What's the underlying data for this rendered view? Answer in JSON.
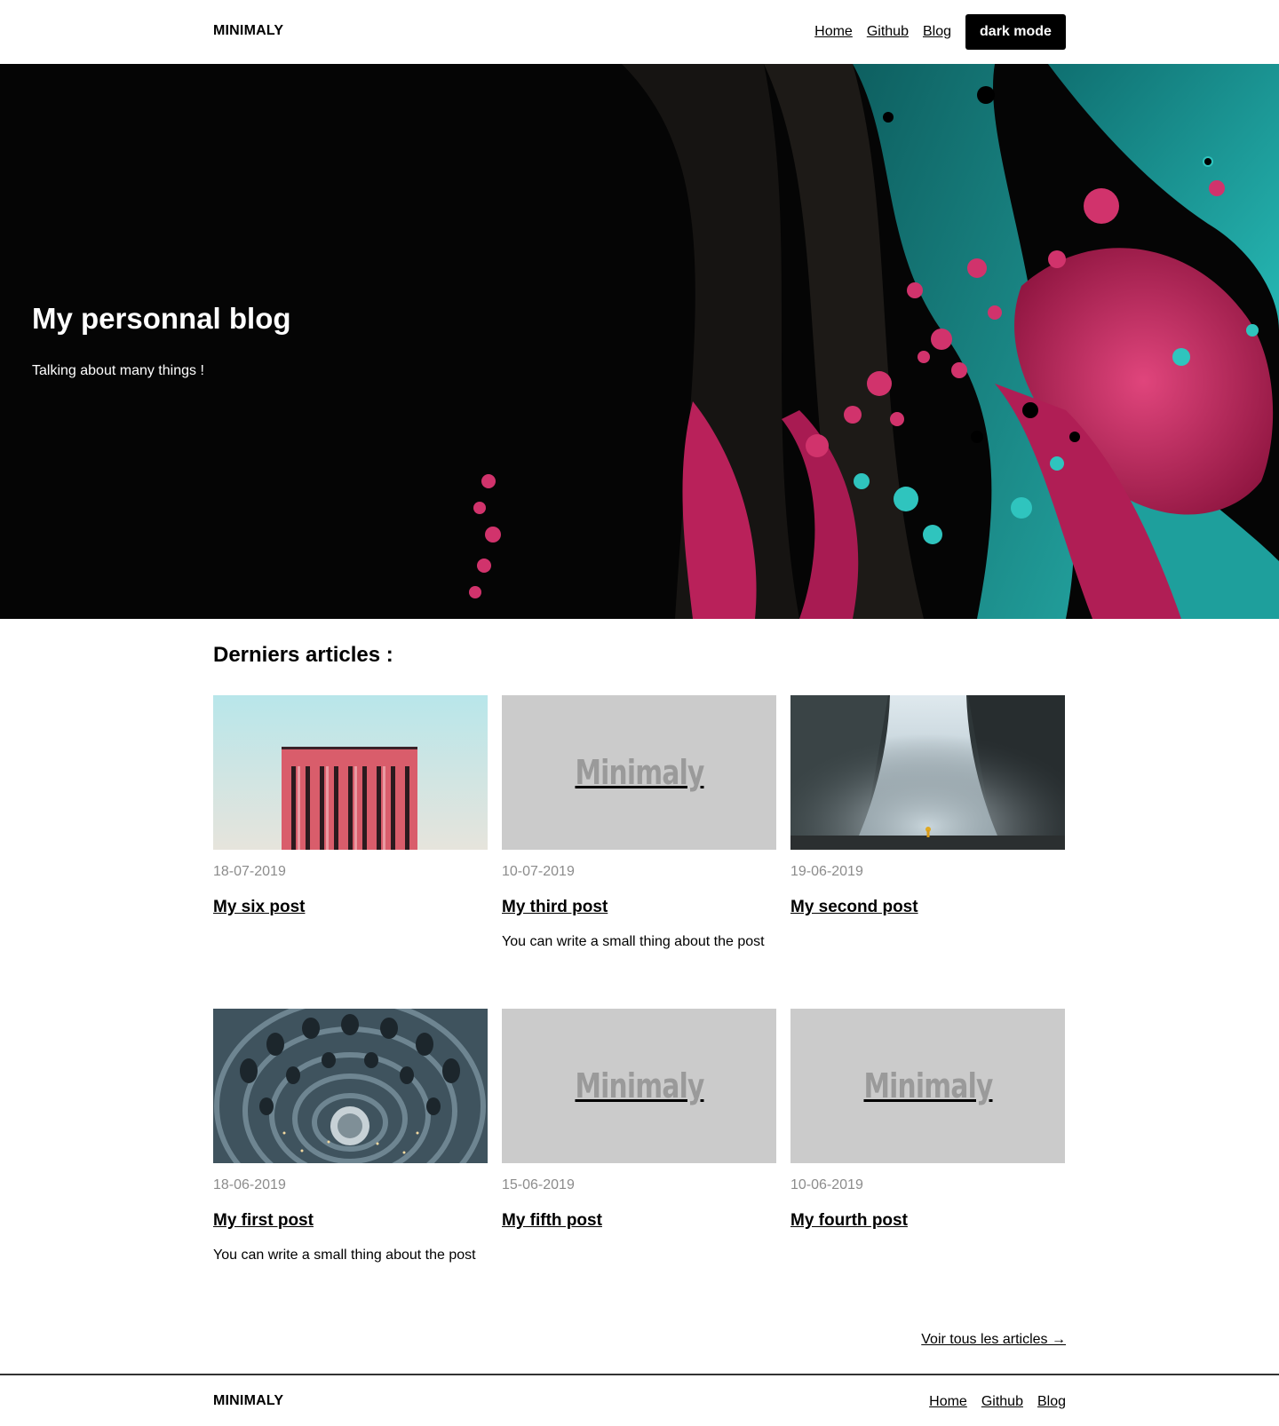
{
  "header": {
    "brand": "MINIMALY",
    "nav": [
      {
        "label": "Home"
      },
      {
        "label": "Github"
      },
      {
        "label": "Blog"
      }
    ],
    "dark_mode_label": "dark mode"
  },
  "hero": {
    "title": "My personnal blog",
    "subtitle": "Talking about many things !",
    "colors": {
      "background": "#050505",
      "pink": "#c8235a",
      "teal": "#1aa7a6"
    }
  },
  "articles": {
    "heading": "Derniers articles :",
    "posts": [
      {
        "date": "18-07-2019",
        "title": "My six post",
        "excerpt": "",
        "image": "red-building"
      },
      {
        "date": "10-07-2019",
        "title": "My third post",
        "excerpt": "You can write a small thing about the post",
        "image": "placeholder"
      },
      {
        "date": "19-06-2019",
        "title": "My second post",
        "excerpt": "",
        "image": "waterfall"
      },
      {
        "date": "18-06-2019",
        "title": "My first post",
        "excerpt": "You can write a small thing about the post",
        "image": "spiral-architecture"
      },
      {
        "date": "15-06-2019",
        "title": "My fifth post",
        "excerpt": "",
        "image": "placeholder"
      },
      {
        "date": "10-06-2019",
        "title": "My fourth post",
        "excerpt": "",
        "image": "placeholder"
      }
    ],
    "placeholder_text": "Minimaly",
    "see_all": "Voir tous les articles →"
  },
  "footer": {
    "brand": "MINIMALY",
    "nav": [
      {
        "label": "Home"
      },
      {
        "label": "Github"
      },
      {
        "label": "Blog"
      }
    ]
  }
}
